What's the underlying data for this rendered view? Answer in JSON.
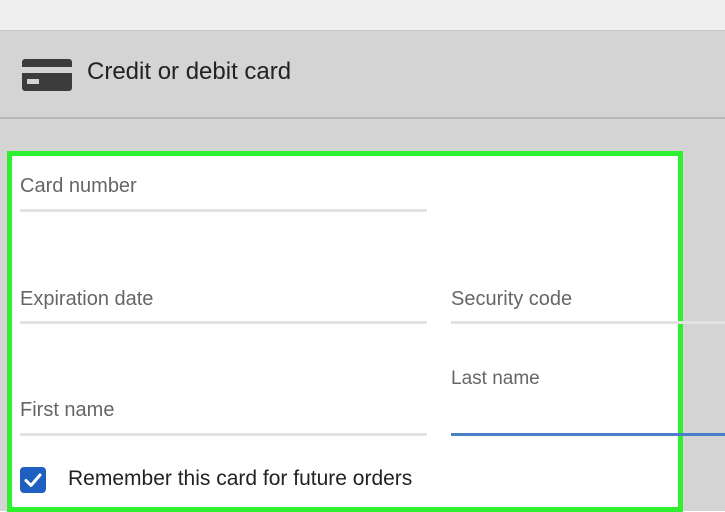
{
  "header": {
    "title": "Credit or debit card",
    "icon": "credit-card-icon"
  },
  "form": {
    "card_number": {
      "placeholder": "Card number",
      "value": ""
    },
    "expiration_date": {
      "placeholder": "Expiration date",
      "value": ""
    },
    "security_code": {
      "placeholder": "Security code",
      "value": ""
    },
    "first_name": {
      "placeholder": "First name",
      "value": ""
    },
    "last_name": {
      "label": "Last name",
      "value": "",
      "focused": true
    },
    "remember": {
      "label": "Remember this card for future orders",
      "checked": true
    }
  },
  "colors": {
    "highlight": "#2ef02e",
    "focus_underline": "#4a7fc7",
    "checkbox": "#1f5fbf",
    "header_bg": "#d4d4d4"
  }
}
